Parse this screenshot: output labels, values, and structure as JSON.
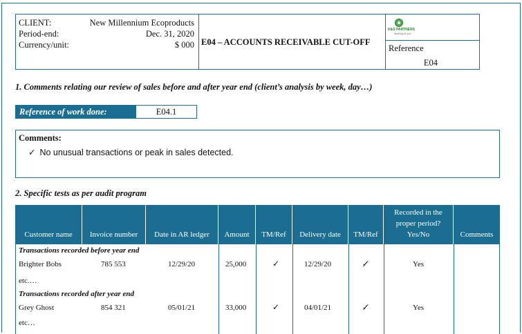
{
  "header": {
    "client_label": "CLIENT:",
    "client_value": "New Millennium Ecoproducts",
    "period_label": "Period-end:",
    "period_value": "Dec. 31, 2020",
    "currency_label": "Currency/unit:",
    "currency_value": "$ 000",
    "title": "E04 – ACCOUNTS RECEIVABLE CUT-OFF",
    "logo_text": "H&S PARTNERS",
    "logo_tagline": "Working for you",
    "reference_label": "Reference",
    "reference_value": "E04"
  },
  "section1": {
    "heading": "1. Comments relating our review of sales before and after year end (client’s analysis by week, day…)",
    "work_done_label": "Reference of work done:",
    "work_done_value": "E04.1",
    "comments_title": "Comments:",
    "comment_check": "✓",
    "comment_item": "No unusual transactions or peak in sales detected."
  },
  "section2": {
    "heading": "2. Specific tests as per audit program",
    "columns": [
      "Customer name",
      "Invoice number",
      "Date in AR ledger",
      "Amount",
      "TM/Ref",
      "Delivery date",
      "TM/Ref",
      "Recorded in the proper period? Yes/No",
      "Comments"
    ],
    "recorded_col_lines": [
      "Recorded in the",
      "proper period?",
      "Yes/No"
    ],
    "group_before": "Transactions recorded before year end",
    "group_after": "Transactions recorded after year end",
    "rows": [
      {
        "customer": "Brighter Bobs",
        "invoice": "785 553",
        "date": "12/29/20",
        "amount": "25,000",
        "tm1": "✓",
        "delivery": "12/29/20",
        "tm2": "✓̸",
        "recorded": "Yes",
        "comments": ""
      },
      {
        "customer": "Grey Ghost",
        "invoice": "854 321",
        "date": "05/01/21",
        "amount": "33,000",
        "tm1": "✓",
        "delivery": "04/01/21",
        "tm2": "✓̸",
        "recorded": "Yes",
        "comments": ""
      }
    ],
    "etc_before": "etc.…",
    "etc_after": "etc…"
  },
  "colors": {
    "accent": "#1b6e92",
    "logo_green": "#4caf50"
  }
}
